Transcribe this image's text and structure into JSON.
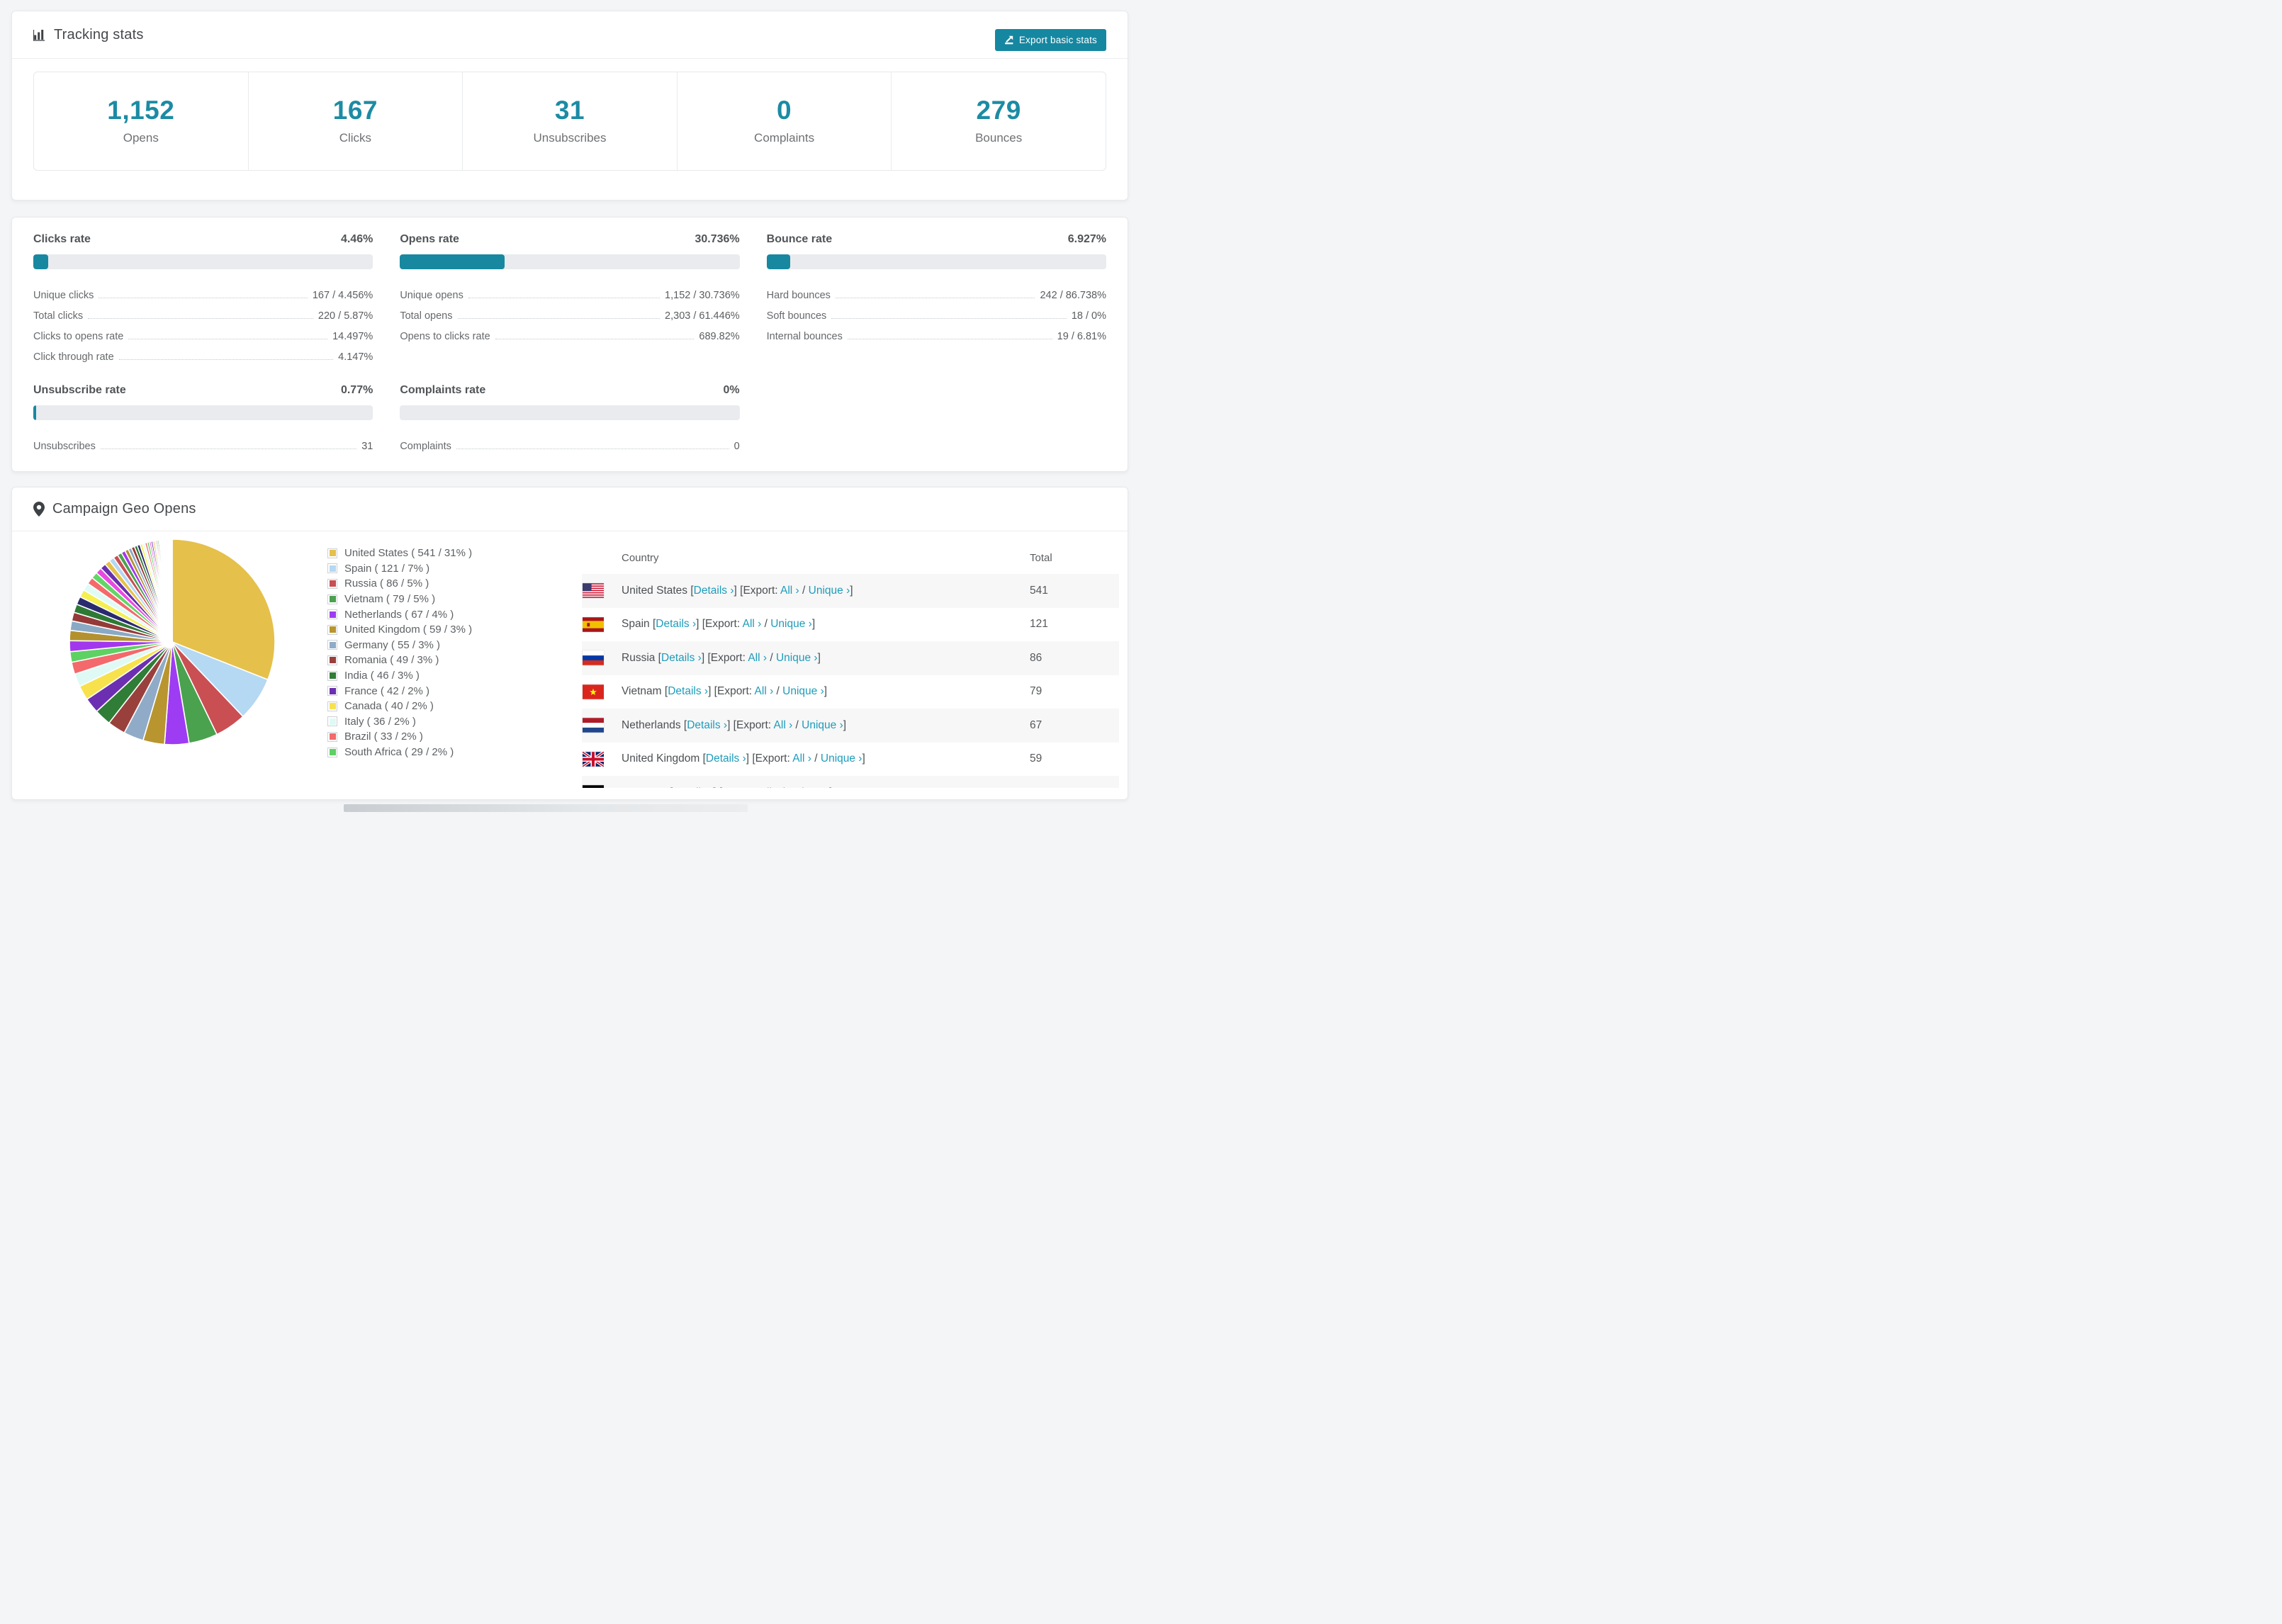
{
  "colors": {
    "accent_teal": "#1687a0",
    "bar_fill": "#1788a0",
    "number_teal": "#1c8ba4",
    "link_blue": "#1e9cba",
    "page_bg": "#f4f5f7",
    "row_stripe": "#f7f7f8"
  },
  "header": {
    "title": "Tracking stats",
    "export_label": "Export basic stats"
  },
  "summary": [
    {
      "value": "1,152",
      "label": "Opens"
    },
    {
      "value": "167",
      "label": "Clicks"
    },
    {
      "value": "31",
      "label": "Unsubscribes"
    },
    {
      "value": "0",
      "label": "Complaints"
    },
    {
      "value": "279",
      "label": "Bounces"
    }
  ],
  "rates": [
    {
      "id": "clicks",
      "title": "Clicks rate",
      "value": "4.46%",
      "pct": 4.46,
      "rows": [
        [
          "Unique clicks",
          "167 / 4.456%"
        ],
        [
          "Total clicks",
          "220 / 5.87%"
        ],
        [
          "Clicks to opens rate",
          "14.497%"
        ],
        [
          "Click through rate",
          "4.147%"
        ]
      ]
    },
    {
      "id": "opens",
      "title": "Opens rate",
      "value": "30.736%",
      "pct": 30.736,
      "rows": [
        [
          "Unique opens",
          "1,152 / 30.736%"
        ],
        [
          "Total opens",
          "2,303 / 61.446%"
        ],
        [
          "Opens to clicks rate",
          "689.82%"
        ]
      ]
    },
    {
      "id": "bounce",
      "title": "Bounce rate",
      "value": "6.927%",
      "pct": 6.927,
      "rows": [
        [
          "Hard bounces",
          "242 / 86.738%"
        ],
        [
          "Soft bounces",
          "18 / 0%"
        ],
        [
          "Internal bounces",
          "19 / 6.81%"
        ]
      ]
    },
    {
      "id": "unsubscribe",
      "title": "Unsubscribe rate",
      "value": "0.77%",
      "pct": 0.77,
      "rows": [
        [
          "Unsubscribes",
          "31"
        ]
      ]
    },
    {
      "id": "complaints",
      "title": "Complaints rate",
      "value": "0%",
      "pct": 0,
      "rows": [
        [
          "Complaints",
          "0"
        ]
      ]
    }
  ],
  "geo": {
    "title": "Campaign Geo Opens",
    "chart_data": {
      "type": "pie",
      "title": "Campaign Geo Opens",
      "labels": [
        "United States",
        "Spain",
        "Russia",
        "Vietnam",
        "Netherlands",
        "United Kingdom",
        "Germany",
        "Romania",
        "India",
        "France",
        "Canada",
        "Italy",
        "Brazil",
        "South Africa"
      ],
      "values": [
        541,
        121,
        86,
        79,
        67,
        59,
        55,
        49,
        46,
        42,
        40,
        36,
        33,
        29
      ],
      "percent_labels": [
        "31%",
        "7%",
        "5%",
        "5%",
        "4%",
        "3%",
        "3%",
        "3%",
        "3%",
        "2%",
        "2%",
        "2%",
        "2%",
        "2%"
      ],
      "other_values": [
        30,
        28,
        26,
        24,
        23,
        22,
        21,
        21,
        19,
        18,
        17,
        16,
        15,
        14,
        13,
        12,
        11,
        10,
        9,
        9,
        8,
        8,
        7,
        7,
        6,
        6,
        5,
        5,
        5,
        4,
        4,
        4,
        3,
        3,
        3,
        3,
        2,
        2,
        2,
        2,
        2,
        2,
        1,
        1,
        1,
        1,
        1,
        1,
        1,
        1,
        1,
        1,
        1,
        1
      ],
      "colors": [
        "#e5c04b",
        "#b5d8f3",
        "#c94f53",
        "#4aa24e",
        "#9d3cf2",
        "#b8952f",
        "#8fabc7",
        "#99403d",
        "#2f7d36",
        "#6c2fb2",
        "#f7e24d",
        "#dffaf5",
        "#f4696b",
        "#5dd163"
      ],
      "tail_colors": [
        "#a138ee",
        "#b3912f",
        "#8aa9c5",
        "#953a38",
        "#2e7a35",
        "#2a2a6e",
        "#f5ef52",
        "#e0fbf6",
        "#f4696b",
        "#63d568",
        "#e84ae0",
        "#6930ac",
        "#e5c04b",
        "#b5d8f3",
        "#c94f53",
        "#4aa24e"
      ],
      "start_angle_deg": -90,
      "direction": "clockwise",
      "legend_position": "right"
    },
    "legend": [
      "United States ( 541 / 31% )",
      "Spain ( 121 / 7% )",
      "Russia ( 86 / 5% )",
      "Vietnam ( 79 / 5% )",
      "Netherlands ( 67 / 4% )",
      "United Kingdom ( 59 / 3% )",
      "Germany ( 55 / 3% )",
      "Romania ( 49 / 3% )",
      "India ( 46 / 3% )",
      "France ( 42 / 2% )",
      "Canada ( 40 / 2% )",
      "Italy ( 36 / 2% )",
      "Brazil ( 33 / 2% )",
      "South Africa ( 29 / 2% )"
    ],
    "table": {
      "columns": [
        "Country",
        "Total"
      ],
      "links": {
        "details_label": "Details ›",
        "export_prefix": "[Export: ",
        "all_label": "All ›",
        "separator": " / ",
        "unique_label": "Unique ›"
      },
      "rows": [
        {
          "country": "United States",
          "flag": "us",
          "total": "541"
        },
        {
          "country": "Spain",
          "flag": "es",
          "total": "121"
        },
        {
          "country": "Russia",
          "flag": "ru",
          "total": "86"
        },
        {
          "country": "Vietnam",
          "flag": "vn",
          "total": "79"
        },
        {
          "country": "Netherlands",
          "flag": "nl",
          "total": "67"
        },
        {
          "country": "United Kingdom",
          "flag": "gb",
          "total": "59"
        },
        {
          "country": "Germany",
          "flag": "de",
          "total": ""
        }
      ]
    }
  }
}
